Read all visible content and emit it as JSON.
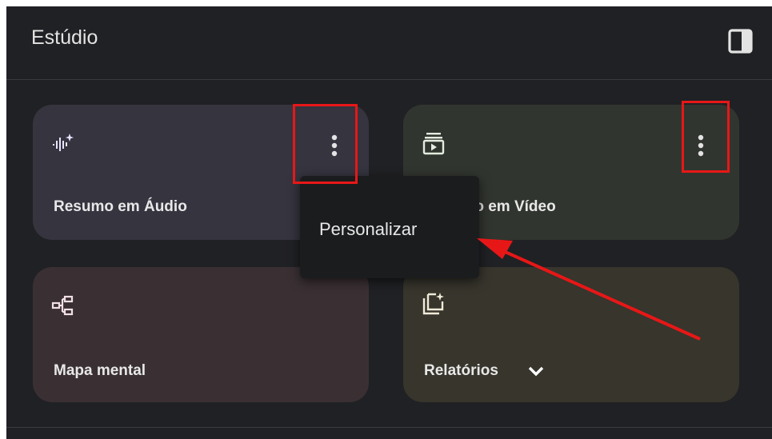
{
  "header": {
    "title": "Estúdio",
    "toggle_icon": "side-panel-icon"
  },
  "cards": [
    {
      "label": "Resumo em Áudio",
      "icon": "audio-sparkle-icon",
      "bg": "#35343f",
      "has_menu": true
    },
    {
      "label": "Resumo em Vídeo",
      "icon": "video-playlist-icon",
      "bg": "#31352f",
      "has_menu": true
    },
    {
      "label": "Mapa mental",
      "icon": "mind-map-icon",
      "bg": "#3a3033",
      "has_menu": false
    },
    {
      "label": "Relatórios",
      "icon": "report-sparkle-icon",
      "bg": "#37352c",
      "has_menu": false,
      "dropdown_icon": "chevron-down-icon"
    }
  ],
  "context_menu": {
    "items": [
      {
        "label": "Personalizar"
      }
    ]
  },
  "colors": {
    "panel_bg": "#202124",
    "annotation": "#e81717",
    "text": "#e8e8e8"
  }
}
